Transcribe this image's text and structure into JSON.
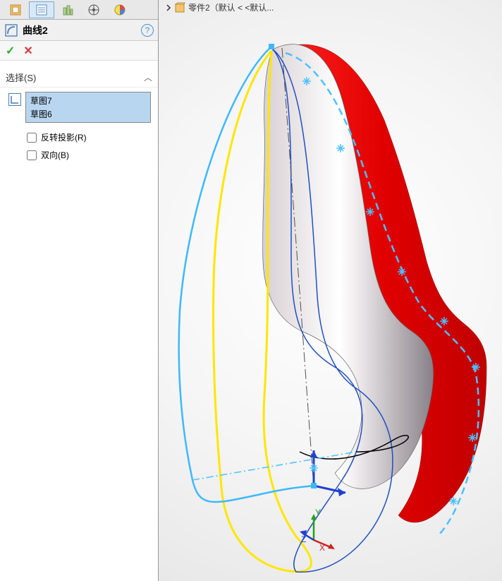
{
  "feature": {
    "title": "曲线2",
    "help_tooltip": "?"
  },
  "confirm": {
    "ok": "✓",
    "cancel": "✕"
  },
  "selection_section": {
    "title": "选择(S)",
    "toggle": "︿",
    "items": [
      "草图7",
      "草图6"
    ]
  },
  "options": {
    "reverse_label": "反转投影(R)",
    "bidirectional_label": "双向(B)",
    "reverse_checked": false,
    "bidirectional_checked": false
  },
  "breadcrumb": {
    "part_text": "零件2（默认 < <默认..."
  },
  "triad": {
    "x": "X",
    "y": "Y",
    "z": "Z"
  }
}
